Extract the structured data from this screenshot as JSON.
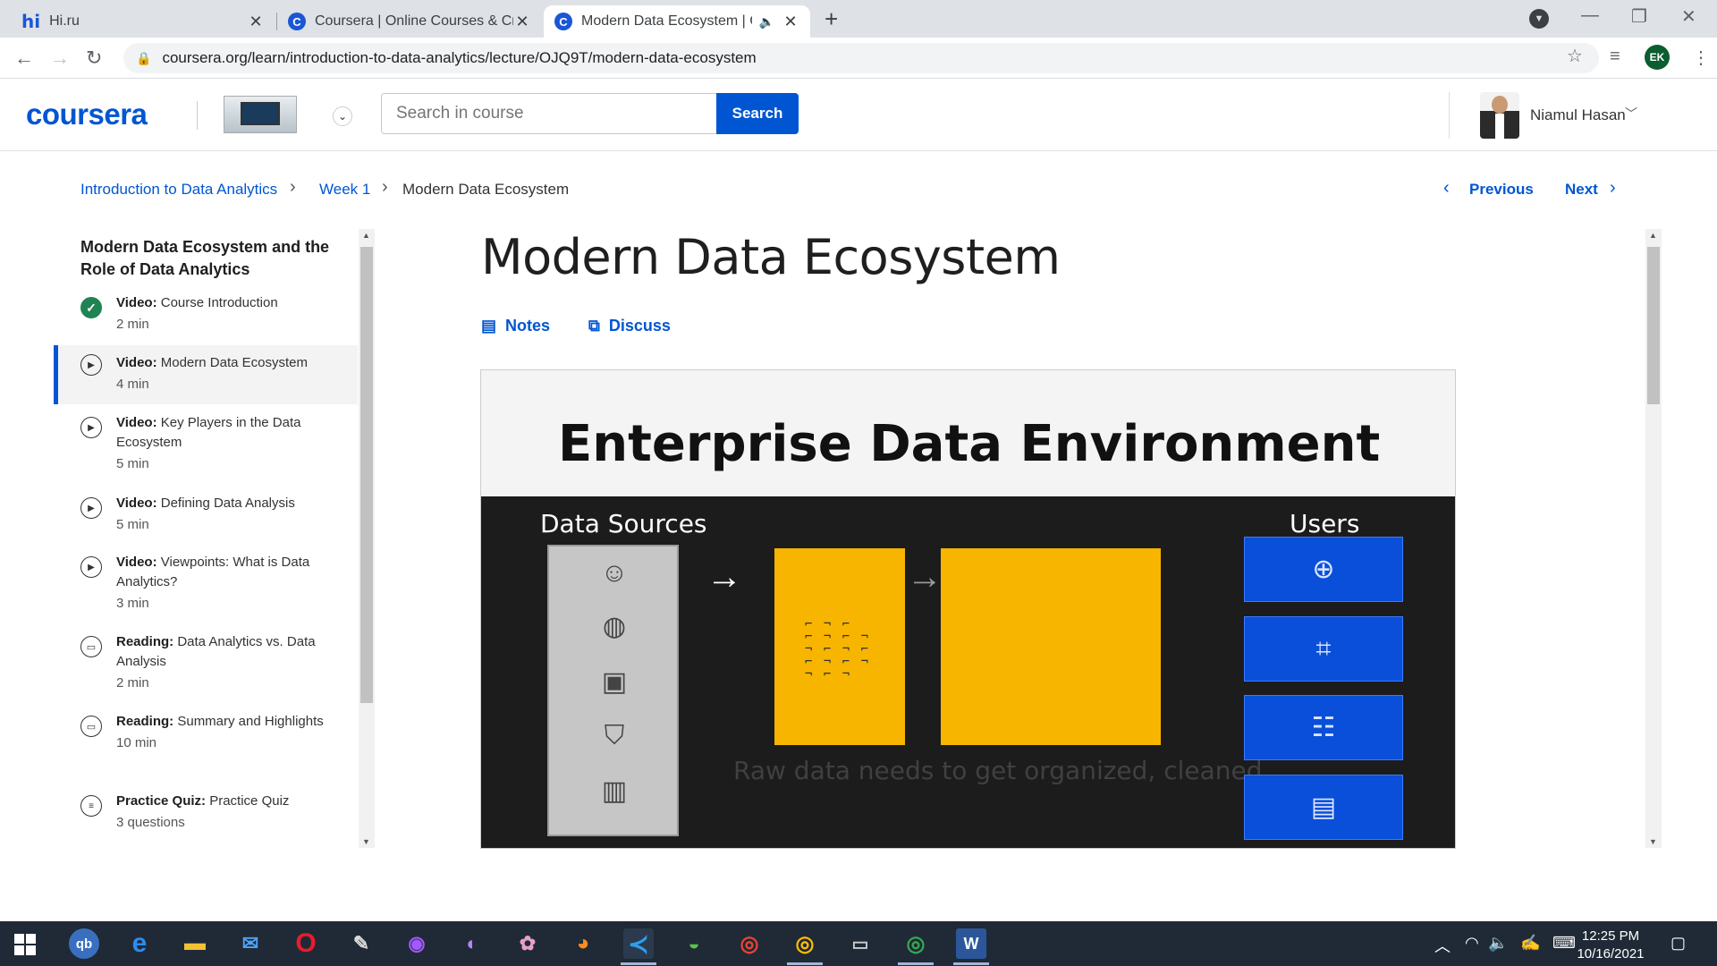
{
  "browser": {
    "tabs": [
      {
        "title": "Hi.ru",
        "favicon": "hi-favicon"
      },
      {
        "title": "Coursera | Online Courses & Crec",
        "favicon": "coursera-favicon"
      },
      {
        "title": "Modern Data Ecosystem | Co",
        "favicon": "coursera-favicon",
        "active": true,
        "audio": true
      }
    ],
    "url": "coursera.org/learn/introduction-to-data-analytics/lecture/OJQ9T/modern-data-ecosystem",
    "profile_initials": "EK"
  },
  "header": {
    "logo": "coursera",
    "search_placeholder": "Search in course",
    "search_button": "Search",
    "user_name": "Niamul Hasan"
  },
  "breadcrumb": {
    "course": "Introduction to Data Analytics",
    "week": "Week 1",
    "current": "Modern Data Ecosystem"
  },
  "pager": {
    "previous": "Previous",
    "next": "Next"
  },
  "sidebar": {
    "module_title": "Modern Data Ecosystem and the Role of Data Analytics",
    "items": [
      {
        "type": "Video:",
        "title": "Course Introduction",
        "meta": "2 min",
        "status": "done"
      },
      {
        "type": "Video:",
        "title": "Modern Data Ecosystem",
        "meta": "4 min",
        "status": "active"
      },
      {
        "type": "Video:",
        "title": "Key Players in the Data Ecosystem",
        "meta": "5 min",
        "status": "todo"
      },
      {
        "type": "Video:",
        "title": "Defining Data Analysis",
        "meta": "5 min",
        "status": "todo"
      },
      {
        "type": "Video:",
        "title": "Viewpoints: What is Data Analytics?",
        "meta": "3 min",
        "status": "todo"
      },
      {
        "type": "Reading:",
        "title": "Data Analytics vs. Data Analysis",
        "meta": "2 min",
        "status": "todo"
      },
      {
        "type": "Reading:",
        "title": "Summary and Highlights",
        "meta": "10 min",
        "status": "todo"
      },
      {
        "type": "Practice Quiz:",
        "title": "Practice Quiz",
        "meta": "3 questions",
        "status": "todo"
      }
    ]
  },
  "main": {
    "title": "Modern Data Ecosystem",
    "notes_label": "Notes",
    "discuss_label": "Discuss"
  },
  "slide": {
    "title": "Enterprise Data Environment",
    "sources_label": "Data Sources",
    "users_label": "Users",
    "caption": "Raw data needs to get organized, cleaned"
  },
  "taskbar": {
    "time": "12:25 PM",
    "date": "10/16/2021"
  },
  "colors": {
    "brand": "#0056d2",
    "slide_yellow": "#f7b500",
    "slide_blue": "#0a4fd9",
    "done_green": "#1f8354"
  }
}
